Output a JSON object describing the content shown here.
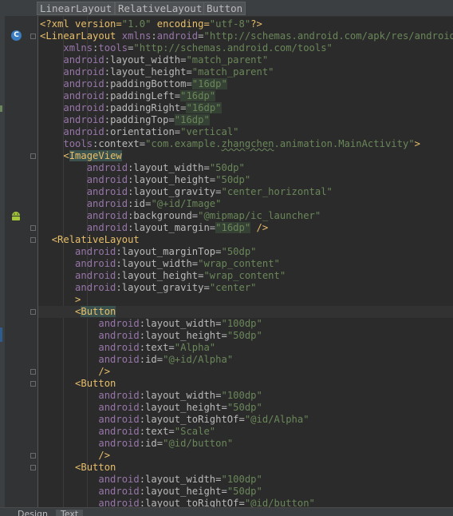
{
  "breadcrumbs": [
    "LinearLayout",
    "RelativeLayout",
    "Button"
  ],
  "bottom_tabs": [
    "Design",
    "Text"
  ],
  "gutter_icons": {
    "class_icon": "C"
  },
  "code_lines": [
    {
      "indent": 0,
      "parts": [
        [
          "pi",
          "<?xml version="
        ],
        [
          "val",
          "\"1.0\""
        ],
        [
          "pi",
          " encoding="
        ],
        [
          "val",
          "\"utf-8\""
        ],
        [
          "pi",
          "?>"
        ]
      ]
    },
    {
      "indent": 0,
      "parts": [
        [
          "tag",
          "<LinearLayout "
        ],
        [
          "ns",
          "xmlns"
        ],
        [
          "attr",
          ":"
        ],
        [
          "ns",
          "android"
        ],
        [
          "attr",
          "="
        ],
        [
          "val",
          "\"http://schemas.android.com/apk/res/android\""
        ]
      ]
    },
    {
      "indent": 4,
      "parts": [
        [
          "ns",
          "xmlns"
        ],
        [
          "attr",
          ":"
        ],
        [
          "ns",
          "tools"
        ],
        [
          "attr",
          "="
        ],
        [
          "val",
          "\"http://schemas.android.com/tools\""
        ]
      ]
    },
    {
      "indent": 4,
      "parts": [
        [
          "ns",
          "android"
        ],
        [
          "attr",
          ":layout_width="
        ],
        [
          "val",
          "\"match_parent\""
        ]
      ]
    },
    {
      "indent": 4,
      "parts": [
        [
          "ns",
          "android"
        ],
        [
          "attr",
          ":layout_height="
        ],
        [
          "val",
          "\"match_parent\""
        ]
      ]
    },
    {
      "indent": 4,
      "parts": [
        [
          "ns",
          "android"
        ],
        [
          "attr",
          ":paddingBottom="
        ],
        [
          "valhl",
          "\"16dp\""
        ]
      ]
    },
    {
      "indent": 4,
      "parts": [
        [
          "ns",
          "android"
        ],
        [
          "attr",
          ":paddingLeft="
        ],
        [
          "valhl",
          "\"16dp\""
        ]
      ]
    },
    {
      "indent": 4,
      "parts": [
        [
          "ns",
          "android"
        ],
        [
          "attr",
          ":paddingRight="
        ],
        [
          "valhl",
          "\"16dp\""
        ]
      ]
    },
    {
      "indent": 4,
      "parts": [
        [
          "ns",
          "android"
        ],
        [
          "attr",
          ":paddingTop="
        ],
        [
          "valhl",
          "\"16dp\""
        ]
      ]
    },
    {
      "indent": 4,
      "parts": [
        [
          "ns",
          "android"
        ],
        [
          "attr",
          ":orientation="
        ],
        [
          "val",
          "\"vertical\""
        ]
      ]
    },
    {
      "indent": 4,
      "parts": [
        [
          "ns",
          "tools"
        ],
        [
          "attr",
          ":context="
        ],
        [
          "val",
          "\"com.example."
        ],
        [
          "valsq",
          "zhangchen"
        ],
        [
          "val",
          ".animation.MainActivity\""
        ],
        [
          "tag",
          ">"
        ]
      ]
    },
    {
      "indent": 4,
      "parts": [
        [
          "tag",
          "<"
        ],
        [
          "tagbg",
          "ImageView"
        ]
      ]
    },
    {
      "indent": 8,
      "parts": [
        [
          "ns",
          "android"
        ],
        [
          "attr",
          ":layout_width="
        ],
        [
          "val",
          "\"50dp\""
        ]
      ]
    },
    {
      "indent": 8,
      "parts": [
        [
          "ns",
          "android"
        ],
        [
          "attr",
          ":layout_height="
        ],
        [
          "val",
          "\"50dp\""
        ]
      ]
    },
    {
      "indent": 8,
      "parts": [
        [
          "ns",
          "android"
        ],
        [
          "attr",
          ":layout_gravity="
        ],
        [
          "val",
          "\"center_horizontal\""
        ]
      ]
    },
    {
      "indent": 8,
      "parts": [
        [
          "ns",
          "android"
        ],
        [
          "attr",
          ":id="
        ],
        [
          "val",
          "\"@+id/Image\""
        ]
      ]
    },
    {
      "indent": 8,
      "parts": [
        [
          "ns",
          "android"
        ],
        [
          "attr",
          ":background="
        ],
        [
          "val",
          "\"@mipmap/ic_launcher\""
        ]
      ]
    },
    {
      "indent": 8,
      "parts": [
        [
          "ns",
          "android"
        ],
        [
          "attr",
          ":layout_margin="
        ],
        [
          "valhl",
          "\"16dp\""
        ],
        [
          "tag",
          " />"
        ]
      ]
    },
    {
      "indent": 2,
      "parts": [
        [
          "tag",
          "<RelativeLayout"
        ]
      ]
    },
    {
      "indent": 6,
      "parts": [
        [
          "ns",
          "android"
        ],
        [
          "attr",
          ":layout_marginTop="
        ],
        [
          "val",
          "\"50dp\""
        ]
      ]
    },
    {
      "indent": 6,
      "parts": [
        [
          "ns",
          "android"
        ],
        [
          "attr",
          ":layout_width="
        ],
        [
          "val",
          "\"wrap_content\""
        ]
      ]
    },
    {
      "indent": 6,
      "parts": [
        [
          "ns",
          "android"
        ],
        [
          "attr",
          ":layout_height="
        ],
        [
          "val",
          "\"wrap_content\""
        ]
      ]
    },
    {
      "indent": 6,
      "parts": [
        [
          "ns",
          "android"
        ],
        [
          "attr",
          ":layout_gravity="
        ],
        [
          "val",
          "\"center\""
        ]
      ]
    },
    {
      "indent": 6,
      "parts": [
        [
          "tag",
          ">"
        ]
      ]
    },
    {
      "indent": 6,
      "parts": [
        [
          "tag",
          "<"
        ],
        [
          "tagbg",
          "Button"
        ]
      ],
      "current": true
    },
    {
      "indent": 10,
      "parts": [
        [
          "ns",
          "android"
        ],
        [
          "attr",
          ":layout_width="
        ],
        [
          "val",
          "\"100dp\""
        ]
      ]
    },
    {
      "indent": 10,
      "parts": [
        [
          "ns",
          "android"
        ],
        [
          "attr",
          ":layout_height="
        ],
        [
          "val",
          "\"50dp\""
        ]
      ]
    },
    {
      "indent": 10,
      "parts": [
        [
          "ns",
          "android"
        ],
        [
          "attr",
          ":text="
        ],
        [
          "val",
          "\"Alpha\""
        ]
      ]
    },
    {
      "indent": 10,
      "parts": [
        [
          "ns",
          "android"
        ],
        [
          "attr",
          ":id="
        ],
        [
          "val",
          "\"@+id/Alpha\""
        ]
      ]
    },
    {
      "indent": 10,
      "parts": [
        [
          "tag",
          "/>"
        ]
      ]
    },
    {
      "indent": 6,
      "parts": [
        [
          "tag",
          "<Button"
        ]
      ]
    },
    {
      "indent": 10,
      "parts": [
        [
          "ns",
          "android"
        ],
        [
          "attr",
          ":layout_width="
        ],
        [
          "val",
          "\"100dp\""
        ]
      ]
    },
    {
      "indent": 10,
      "parts": [
        [
          "ns",
          "android"
        ],
        [
          "attr",
          ":layout_height="
        ],
        [
          "val",
          "\"50dp\""
        ]
      ]
    },
    {
      "indent": 10,
      "parts": [
        [
          "ns",
          "android"
        ],
        [
          "attr",
          ":layout_toRightOf="
        ],
        [
          "val",
          "\"@id/Alpha\""
        ]
      ]
    },
    {
      "indent": 10,
      "parts": [
        [
          "ns",
          "android"
        ],
        [
          "attr",
          ":text="
        ],
        [
          "val",
          "\"Scale\""
        ]
      ]
    },
    {
      "indent": 10,
      "parts": [
        [
          "ns",
          "android"
        ],
        [
          "attr",
          ":id="
        ],
        [
          "val",
          "\"@id/button\""
        ]
      ]
    },
    {
      "indent": 10,
      "parts": [
        [
          "tag",
          "/>"
        ]
      ]
    },
    {
      "indent": 6,
      "parts": [
        [
          "tag",
          "<Button"
        ]
      ]
    },
    {
      "indent": 10,
      "parts": [
        [
          "ns",
          "android"
        ],
        [
          "attr",
          ":layout_width="
        ],
        [
          "val",
          "\"100dp\""
        ]
      ]
    },
    {
      "indent": 10,
      "parts": [
        [
          "ns",
          "android"
        ],
        [
          "attr",
          ":layout_height="
        ],
        [
          "val",
          "\"50dp\""
        ]
      ]
    },
    {
      "indent": 10,
      "parts": [
        [
          "ns",
          "android"
        ],
        [
          "attr",
          ":layout_toRightOf="
        ],
        [
          "val",
          "\"@id/button\""
        ]
      ]
    }
  ]
}
